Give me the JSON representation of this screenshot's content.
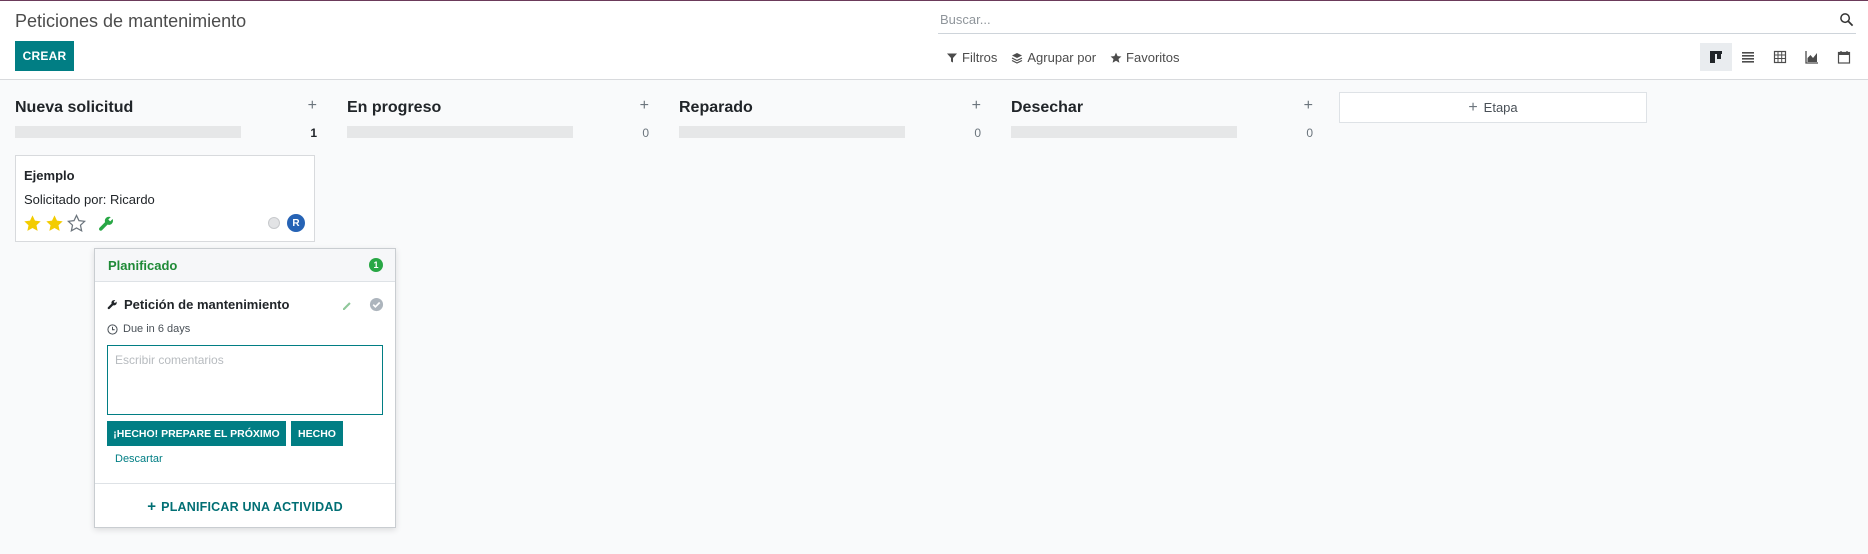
{
  "page": {
    "title": "Peticiones de mantenimiento"
  },
  "toolbar": {
    "create_label": "CREAR",
    "search_placeholder": "Buscar...",
    "filters_label": "Filtros",
    "group_by_label": "Agrupar por",
    "favorites_label": "Favoritos",
    "views": [
      "kanban-icon",
      "list-icon",
      "pivot-icon",
      "graph-icon",
      "calendar-icon"
    ],
    "active_view": "kanban-icon"
  },
  "columns": [
    {
      "title": "Nueva solicitud",
      "count": "1"
    },
    {
      "title": "En progreso",
      "count": "0"
    },
    {
      "title": "Reparado",
      "count": "0"
    },
    {
      "title": "Desechar",
      "count": "0"
    }
  ],
  "add_stage_label": "Etapa",
  "card": {
    "title": "Ejemplo",
    "requested_by": "Solicitado por: Ricardo",
    "rating": 2,
    "rating_max": 3,
    "avatar_initial": "R",
    "colors": {
      "star": "#f3cc00",
      "wrench": "#28a745",
      "avatar": "#2663b5"
    }
  },
  "activity_popover": {
    "header": "Planificado",
    "badge_count": "1",
    "activity_name": "Petición de mantenimiento",
    "due_text": "Due in 6 days",
    "comment_placeholder": "Escribir comentarios",
    "done_next_label": "¡HECHO! PREPARE EL PRÓXIMO",
    "done_label": "HECHO",
    "discard_label": "Descartar",
    "schedule_label": "PLANIFICAR UNA ACTIVIDAD"
  },
  "colors": {
    "primary": "#017e84",
    "success": "#28a745",
    "brand_top": "#6b3a5a"
  }
}
